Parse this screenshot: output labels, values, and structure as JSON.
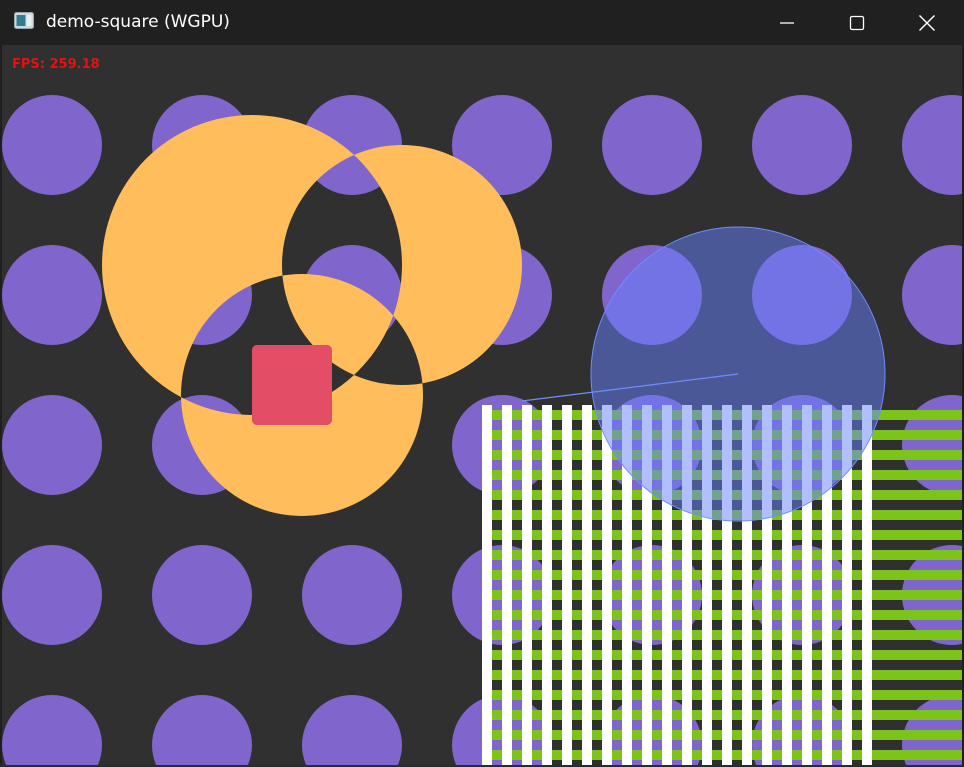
{
  "window": {
    "title": "demo-square (WGPU)",
    "app_icon": "app-window-icon",
    "controls": {
      "minimize_icon": "minimize-icon",
      "maximize_icon": "maximize-icon",
      "close_icon": "close-icon"
    }
  },
  "overlay": {
    "fps_text": "FPS: 259.18",
    "fps_color": "#e81010"
  },
  "scene": {
    "background_color": "#303030",
    "dot_color": "#8066cc",
    "ring_color": "#ffbd5c",
    "square_color": "#e34d66",
    "bubble_color": "#6680ff",
    "stripe_green": "#7dc41a",
    "stripe_white": "#ffffff"
  }
}
